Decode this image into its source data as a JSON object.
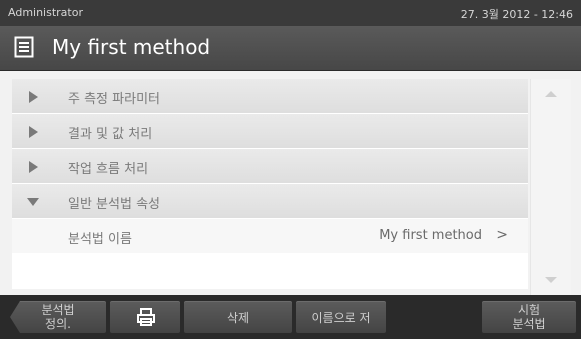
{
  "status": {
    "user": "Administrator",
    "datetime": "27. 3월 2012 - 12:46"
  },
  "title": {
    "text": "My first method"
  },
  "list": {
    "items": [
      {
        "label": "주 측정 파라미터"
      },
      {
        "label": "결과 및 값 처리"
      },
      {
        "label": "작업 흐름 처리"
      },
      {
        "label": "일반 분석법 속성"
      }
    ],
    "sub": {
      "label": "분석법 이름",
      "value": "My first method",
      "chevron": ">"
    }
  },
  "bottom": {
    "back_line1": "분석법",
    "back_line2": "정의.",
    "delete": "삭제",
    "save_as": "이름으로 저",
    "test_line1": "시험",
    "test_line2": "분석법"
  },
  "icons": {
    "title_icon": "method-file-icon",
    "printer": "printer-icon",
    "collapsed": "triangle-right-icon",
    "expanded": "triangle-down-icon",
    "scroll_up": "scroll-up-icon",
    "scroll_down": "scroll-down-icon"
  }
}
